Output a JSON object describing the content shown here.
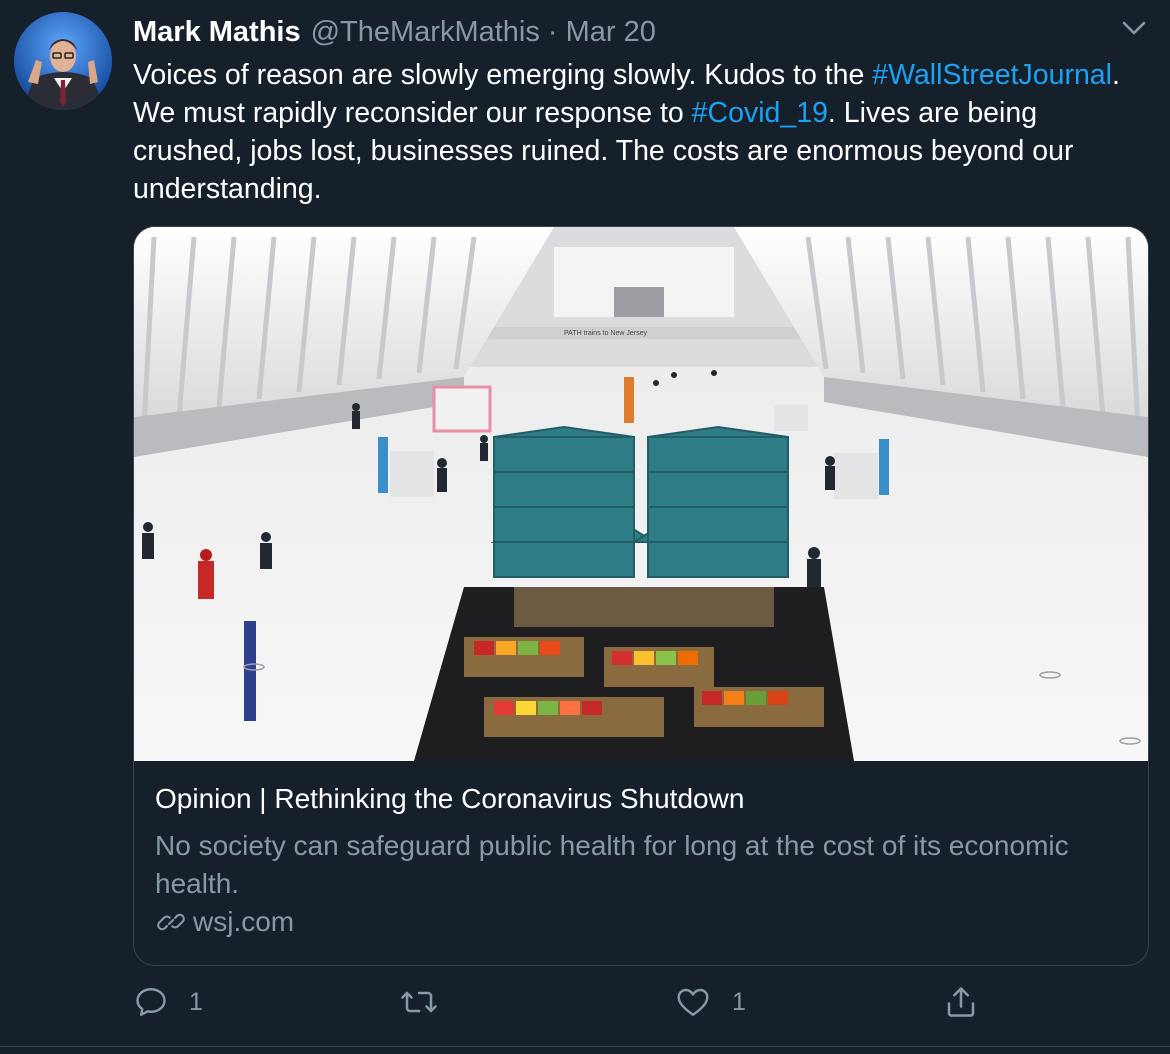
{
  "tweet": {
    "author_name": "Mark Mathis",
    "author_handle": "@TheMarkMathis",
    "separator": "·",
    "date": "Mar 20",
    "text_parts": {
      "p1": "Voices of reason are slowly emerging slowly. Kudos to the ",
      "hashtag1": "#WallStreetJournal",
      "p2": ". We must rapidly reconsider our response to ",
      "hashtag2": "#Covid_19",
      "p3": ". Lives are being crushed, jobs lost, businesses ruined. The costs are enormous beyond our understanding."
    }
  },
  "card": {
    "title": "Opinion | Rethinking the Coronavirus Shutdown",
    "description": "No society can safeguard public health for long at the cost of its economic health.",
    "domain": "wsj.com",
    "image_sign_text": "PATH trains to New Jersey"
  },
  "actions": {
    "reply_count": "1",
    "like_count": "1"
  },
  "colors": {
    "background": "#15202b",
    "accent": "#1da1f2",
    "muted_text": "#8899a6",
    "border": "#38444d",
    "tent": "#2e7d86"
  },
  "icons": [
    "chevron-down-icon",
    "link-icon",
    "reply-icon",
    "retweet-icon",
    "like-icon",
    "share-icon"
  ]
}
